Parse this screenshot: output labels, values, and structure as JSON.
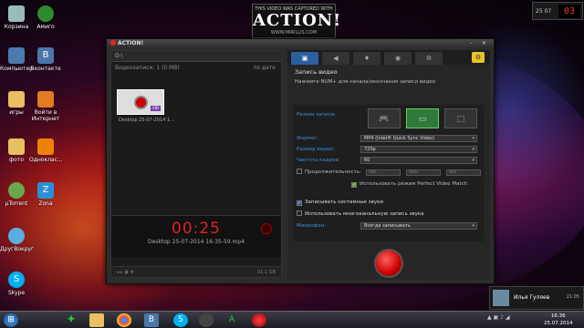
{
  "desktop": {
    "icons": [
      {
        "label": "Корзина"
      },
      {
        "label": "Амиго"
      },
      {
        "label": "Компьютер"
      },
      {
        "label": "Вконтакте"
      },
      {
        "label": "игры"
      },
      {
        "label": "Войти в Интернет"
      },
      {
        "label": "фото"
      },
      {
        "label": "Одноклас..."
      },
      {
        "label": "µTorrent"
      },
      {
        "label": "Zona"
      },
      {
        "label": "ДругВокруг"
      },
      {
        "label": "Skype"
      }
    ]
  },
  "watermark": {
    "line1": "THIS VIDEO WAS CAPTURED WITH",
    "brand": "ACTION!",
    "site": "WWW.MIRILLIS.COM"
  },
  "clock_widget": {
    "date": "25 07",
    "day": "03"
  },
  "app": {
    "title": "ACTION!",
    "path": "D:\\",
    "folder_info": "Видеозаписи: 1 (0 MB)",
    "sort": "по дате",
    "thumb_caption": "Desktop 25-07-2014 1...",
    "thumb_badge": "VID",
    "timer": "00:25",
    "current_file": "Desktop 25-07-2014 16-35-59.mp4",
    "free_space": "91.1 GB",
    "section_title": "Запись видео",
    "hint": "Нажмите NUM+ для начала/окончания записи видео",
    "labels": {
      "mode": "Режим записи:",
      "format": "Формат:",
      "size": "Размер видео:",
      "fps": "Частота кадров:",
      "duration": "Продолжительность:",
      "perfect_match": "Использовать режим Perfect Video Match",
      "sys_sounds": "Записывать системные звуки",
      "multichannel": "Использовать многоканальную запись звука",
      "mic": "Микрофон:"
    },
    "values": {
      "format": "MP4 (Intel® Quick Sync Video)",
      "size": "720p",
      "fps": "60",
      "hh": "00h",
      "mm": "00m",
      "ss": "00s",
      "mic": "Всегда записывать"
    },
    "accent": "#2c5fa0",
    "rec_color": "#cc0000"
  },
  "notification": {
    "name": "Илья Гуляев",
    "time": "21:05"
  },
  "taskbar": {
    "time": "16:36",
    "date": "25.07.2014"
  }
}
